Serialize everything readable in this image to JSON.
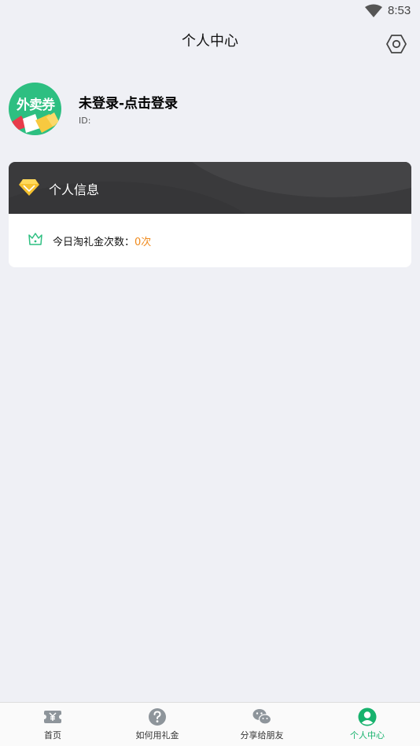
{
  "status_bar": {
    "time": "8:53"
  },
  "header": {
    "title": "个人中心"
  },
  "profile": {
    "avatar_text": "外卖券",
    "login_label": "未登录-点击登录",
    "id_label": "ID:"
  },
  "info_card": {
    "title": "个人信息",
    "tao_label": "今日淘礼金次数：",
    "tao_value": "0次"
  },
  "bottom_nav": {
    "items": [
      {
        "label": "首页",
        "icon": "coupon-icon"
      },
      {
        "label": "如何用礼金",
        "icon": "question-icon"
      },
      {
        "label": "分享给朋友",
        "icon": "wechat-icon"
      },
      {
        "label": "个人中心",
        "icon": "person-icon",
        "active": true
      }
    ]
  },
  "colors": {
    "accent": "#17b26d",
    "value_orange": "#f08a1c",
    "card_header": "#3a3a3c",
    "background": "#eff0f5"
  }
}
